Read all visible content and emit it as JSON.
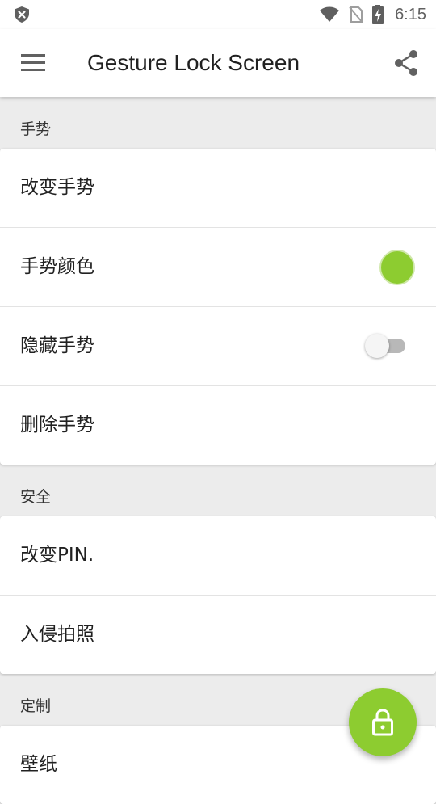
{
  "status_bar": {
    "time": "6:15",
    "icons": [
      "shield-x-icon",
      "wifi-icon",
      "no-sim-icon",
      "battery-charging-icon"
    ]
  },
  "app_bar": {
    "title": "Gesture Lock Screen",
    "menu_icon": "menu-icon",
    "share_icon": "share-icon"
  },
  "sections": [
    {
      "header": "手势",
      "items": [
        {
          "label": "改变手势"
        },
        {
          "label": "手势颜色",
          "swatch_color": "#8dcc30"
        },
        {
          "label": "隐藏手势",
          "toggle": false
        },
        {
          "label": "删除手势"
        }
      ]
    },
    {
      "header": "安全",
      "items": [
        {
          "label": "改变PIN."
        },
        {
          "label": "入侵拍照"
        }
      ]
    },
    {
      "header": "定制",
      "items": [
        {
          "label": "壁纸"
        }
      ]
    }
  ],
  "fab": {
    "icon": "lock-icon",
    "color": "#8dcc30"
  },
  "colors": {
    "accent": "#8dcc30",
    "background": "#ececec",
    "surface": "#ffffff"
  }
}
